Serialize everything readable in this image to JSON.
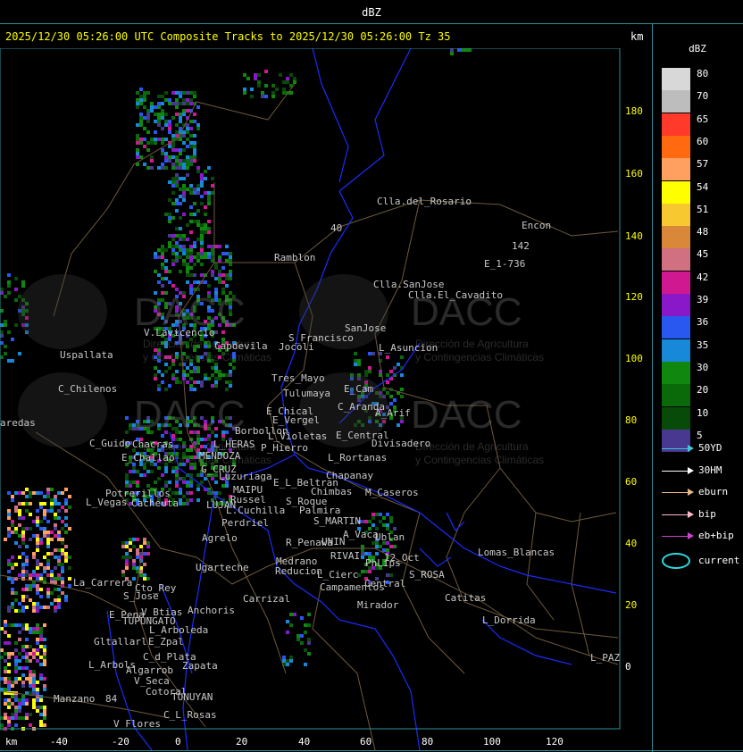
{
  "header": {
    "title": "dBZ"
  },
  "map_title": "2025/12/30 05:26:00 UTC Composite Tracks to 2025/12/30 05:26:00 Tz 35",
  "unit_top": "km",
  "unit_bottom": "km",
  "axes": {
    "x_ticks": [
      "-40",
      "-20",
      "0",
      "20",
      "40",
      "60",
      "80",
      "100",
      "120"
    ],
    "y_ticks": [
      "180",
      "160",
      "140",
      "120",
      "100",
      "80",
      "60",
      "40",
      "20",
      "0"
    ]
  },
  "places": [
    "Clla.del_Rosario",
    "Encon",
    "142",
    "E_1-736",
    "Ramblon",
    "Clla.SanJose",
    "Clla.El_Cavadito",
    "40",
    "Uspallata",
    "V.Lavicencio",
    "Capdevila",
    "S_Francisco",
    "SanJose",
    "L_Asuncion",
    "Jocoli",
    "C_Chilenos",
    "Tres_Mayo",
    "Tulumaya",
    "E_Cam",
    "C_Aranda",
    "E_Chical",
    "E_Vergel",
    "A_Arif",
    "aredas",
    "Borbollon",
    "L_Violetas",
    "E_Central",
    "Divisadero",
    "C_Guido",
    "Chacras",
    "L_HERAS",
    "P_Hierro",
    "L_Rortanas",
    "E_Challao",
    "MENDOZA",
    "G_CRUZ",
    "Luzuriaga",
    "E_L_Beltran",
    "Chapanay",
    "Potrerillos",
    "MAIPU",
    "Chimbas",
    "M_Caseros",
    "L_Vegas",
    "Cacheuta",
    "Russel",
    "S_Roque",
    "LUJAN",
    "Palmira",
    "L.Cuchilla",
    "Perdriel",
    "S_MARTIN",
    "A_Vaca",
    "Ublan",
    "Agrelo",
    "R_Penawa",
    "UNIN",
    "Ugarteche",
    "Medrano",
    "RIVAI",
    "PhLips",
    "12_Oct",
    "Lomas_Blancas",
    "Reducion",
    "S_ROSA",
    "La_Carrera",
    "Cto_Rey",
    "L_Cierc",
    "Central",
    "S_Jose",
    "Carrizal",
    "Campamentos",
    "Catitas",
    "V_Btias",
    "Anchoris",
    "E_Pena",
    "TUPUNGATO",
    "Mirador",
    "L_Dorrida",
    "L_Arboleda",
    "Gltallarl",
    "E_Zpal",
    "C_d_Plata",
    "L_PAZ",
    "L_Arbols",
    "Zapata",
    "Algarrob",
    "Manzano",
    "V_Seca",
    "Cotoral",
    "TUNUYAN",
    "C_L_Rosas",
    "V_Flores",
    "84"
  ],
  "watermark": {
    "brand": "DACC",
    "line1": "Dirección de Agricultura",
    "line2": "y Contingencias Climáticas"
  },
  "legend": {
    "title": "dBZ",
    "scale": [
      {
        "label": "80",
        "color": "#d8d8d8"
      },
      {
        "label": "70",
        "color": "#bdbdbd"
      },
      {
        "label": "65",
        "color": "#ff3a2a"
      },
      {
        "label": "60",
        "color": "#ff6a10"
      },
      {
        "label": "57",
        "color": "#ffa060"
      },
      {
        "label": "54",
        "color": "#ffff00"
      },
      {
        "label": "51",
        "color": "#f8c830"
      },
      {
        "label": "48",
        "color": "#d88838"
      },
      {
        "label": "45",
        "color": "#d07080"
      },
      {
        "label": "42",
        "color": "#d01890"
      },
      {
        "label": "39",
        "color": "#8818c8"
      },
      {
        "label": "36",
        "color": "#2858f0"
      },
      {
        "label": "35",
        "color": "#1888d8"
      },
      {
        "label": "30",
        "color": "#108810"
      },
      {
        "label": "20",
        "color": "#0a6a0a"
      },
      {
        "label": "10",
        "color": "#084a08"
      },
      {
        "label": "5",
        "color": "#483890"
      }
    ],
    "tracks": [
      {
        "label": "50YD",
        "color": "#40c8d8"
      },
      {
        "label": "30HM",
        "color": "#ffffff"
      },
      {
        "label": "eburn",
        "color": "#e8b888"
      },
      {
        "label": "bip",
        "color": "#ffb8c8"
      },
      {
        "label": "eb+bip",
        "color": "#d040d0"
      }
    ],
    "current_label": "current",
    "current_color": "#30d8e0"
  }
}
